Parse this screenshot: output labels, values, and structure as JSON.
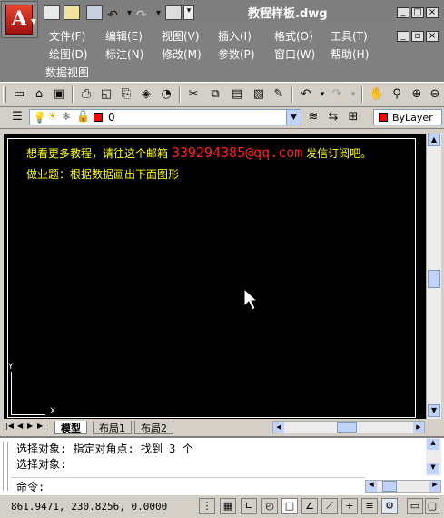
{
  "app": {
    "title": "教程样板.dwg",
    "logo_letter": "A"
  },
  "menu": {
    "row1": [
      "文件(F)",
      "编辑(E)",
      "视图(V)",
      "插入(I)",
      "格式(O)",
      "工具(T)"
    ],
    "row2": [
      "绘图(D)",
      "标注(N)",
      "修改(M)",
      "参数(P)",
      "窗口(W)",
      "帮助(H)"
    ],
    "row3": [
      "数据视图"
    ]
  },
  "layer": {
    "current": "0",
    "color_label": "ByLayer"
  },
  "drawing": {
    "line1_prefix": "想看更多教程，请往这个邮箱",
    "email": "339294385@qq.com",
    "line1_suffix": "发信订阅吧。",
    "line2": "做业题：根据数据画出下面图形",
    "ucs_x": "X",
    "ucs_y": "Y"
  },
  "layout_tabs": [
    "模型",
    "布局1",
    "布局2"
  ],
  "command": {
    "line1": "选择对象: 指定对角点: 找到 3 个",
    "line2": "选择对象:",
    "prompt": "命令:"
  },
  "status": {
    "coords": "861.9471, 230.8256, 0.0000"
  },
  "colors": {
    "layer_swatch": "#ff0000",
    "text_yellow": "#ffff00",
    "email_red": "#ff2020"
  },
  "icons": {
    "quick_access": [
      "new-icon",
      "open-icon",
      "save-icon",
      "undo-icon",
      "redo-icon",
      "plot-icon"
    ],
    "toolbar1": [
      "new-icon",
      "open-icon",
      "save-icon",
      "print-icon",
      "preview-icon",
      "publish-icon",
      "3d-icon",
      "cut-icon",
      "copy-icon",
      "paste-icon",
      "match-icon",
      "brush-icon",
      "undo-icon",
      "redo-icon",
      "pan-icon",
      "zoom-icon",
      "zoom-window-icon",
      "zoom-prev-icon"
    ]
  }
}
